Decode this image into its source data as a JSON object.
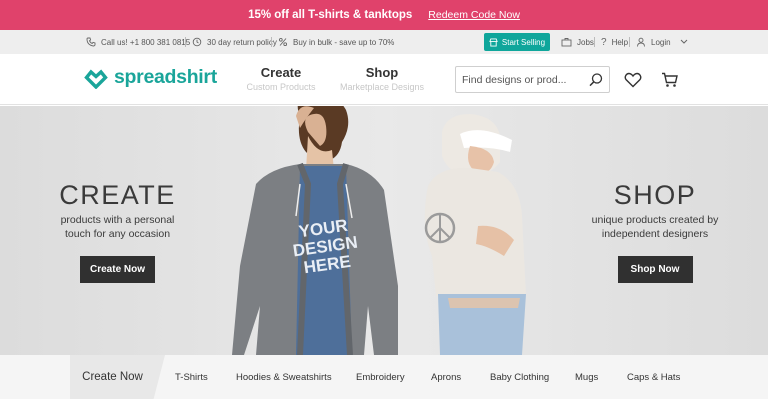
{
  "promo": {
    "message": "15% off all T-shirts & tanktops",
    "link": "Redeem Code Now"
  },
  "utility": {
    "call": "Call us! +1 800 381 0815",
    "returns": "30 day return policy",
    "bulk": "Buy in bulk - save up to 70%",
    "start_selling": "Start Selling",
    "jobs": "Jobs",
    "help": "Help",
    "login": "Login"
  },
  "nav": {
    "logo": "spreadshirt",
    "create": {
      "title": "Create",
      "subtitle": "Custom Products"
    },
    "shop": {
      "title": "Shop",
      "subtitle": "Marketplace Designs"
    },
    "search_placeholder": "Find designs or prod..."
  },
  "hero": {
    "left": {
      "title": "CREATE",
      "text1": "products with a personal",
      "text2": "touch for any occasion",
      "cta": "Create Now"
    },
    "right": {
      "title": "SHOP",
      "text1": "unique products created by",
      "text2": "independent designers",
      "cta": "Shop Now"
    },
    "shirt_text": [
      "YOUR",
      "DESIGN",
      "HERE"
    ]
  },
  "categories": {
    "active": "Create Now",
    "items": [
      "T-Shirts",
      "Hoodies & Sweatshirts",
      "Embroidery",
      "Aprons",
      "Baby Clothing",
      "Mugs",
      "Caps & Hats"
    ]
  },
  "colors": {
    "promo": "#e0426b",
    "brand": "#1aa59a",
    "button": "#303030"
  }
}
